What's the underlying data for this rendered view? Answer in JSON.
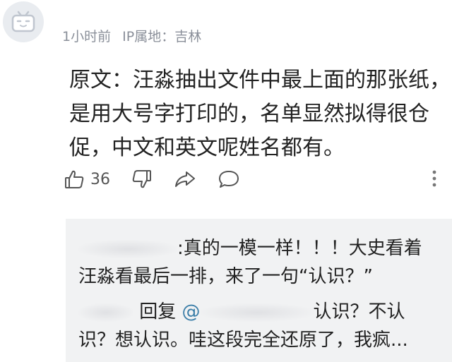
{
  "comment": {
    "time": "1小时前",
    "ip_location": "IP属地：吉林",
    "text": "原文：汪淼抽出文件中最上面的那张纸，是用大号字打印的，名单显然拟得很仓促，中文和英文呢姓名都有。",
    "like_count": "36"
  },
  "replies": [
    {
      "text": ":真的一模一样！！！大史看着汪淼看最后一排，来了一句“认识？”"
    },
    {
      "reply_word": "回复",
      "at_symbol": "@",
      "text": "认识？不认识？想认识。哇这段完全还原了，我疯..."
    }
  ],
  "colors": {
    "reply_bg": "#f1f2f3",
    "meta_text": "#8a8f99",
    "link": "#3b7ea8"
  }
}
